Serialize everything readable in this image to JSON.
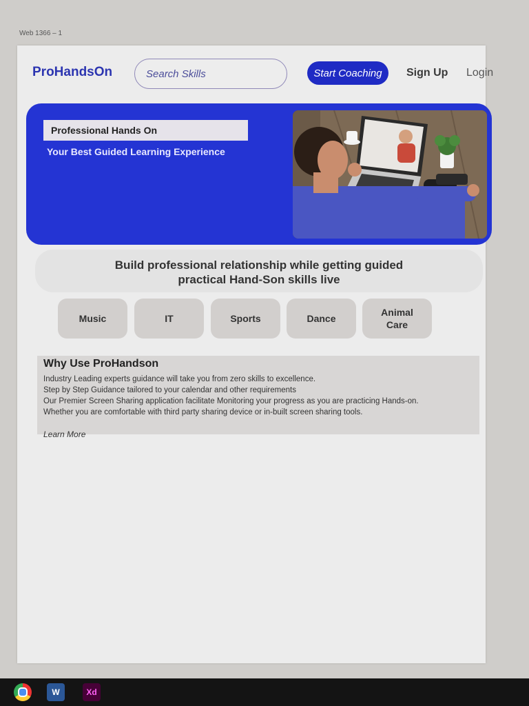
{
  "artboard_label": "Web 1366 – 1",
  "header": {
    "logo": "ProHandsOn",
    "search_placeholder": "Search Skills",
    "start_coaching": "Start Coaching",
    "sign_up": "Sign Up",
    "login": "Login"
  },
  "hero": {
    "headline": "Professional  Hands On",
    "tagline": "Your Best Guided Learning Experience"
  },
  "tagline": {
    "line1": "Build professional relationship while getting guided",
    "line2": "practical Hand-Son skills live"
  },
  "skills": [
    "Music",
    "IT",
    "Sports",
    "Dance",
    "Animal Care"
  ],
  "why": {
    "title": "Why Use ProHandson",
    "lines": [
      "Industry Leading experts guidance will take you from zero skills to excellence.",
      "Step by Step Guidance tailored to your calendar and other requirements",
      "Our Premier Screen Sharing application facilitate Monitoring your progress as you are practicing Hands-on.",
      "Whether you are comfortable with third party sharing device or in-built screen sharing tools."
    ],
    "learn_more": "Learn More"
  },
  "taskbar": {
    "word": "W",
    "xd": "Xd"
  },
  "colors": {
    "brand_blue": "#2434d3",
    "button_blue": "#1f2bc4",
    "logo_blue": "#2c35b0"
  }
}
